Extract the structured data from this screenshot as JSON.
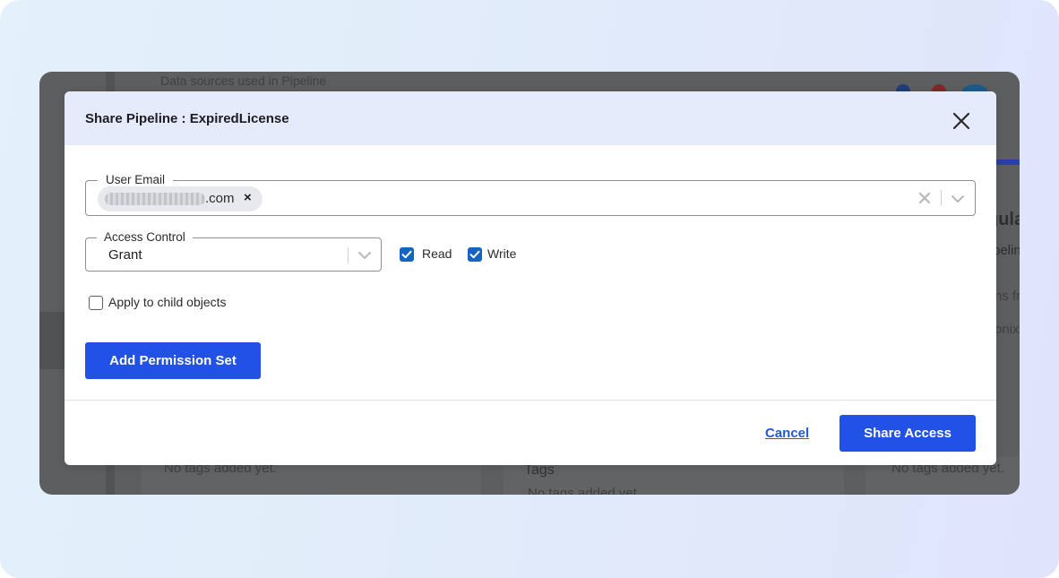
{
  "background": {
    "snippets": [
      "Data sources used in Pipeline",
      "No tags added yet.",
      "Tags",
      "No tags added yet.",
      "No tags added yet.",
      "gula",
      "pelin",
      "ns fr",
      "onix"
    ]
  },
  "modal": {
    "title": "Share Pipeline : ExpiredLicense",
    "user_email": {
      "label": "User Email",
      "chip_suffix": ".com",
      "chip_remove": "×"
    },
    "access_control": {
      "label": "Access Control",
      "value": "Grant"
    },
    "permissions": {
      "read_label": "Read",
      "read_checked": true,
      "write_label": "Write",
      "write_checked": true
    },
    "apply_child": {
      "label": "Apply to child objects",
      "checked": false
    },
    "add_permission_set_label": "Add Permission Set",
    "cancel_label": "Cancel",
    "share_access_label": "Share Access"
  },
  "colors": {
    "primary": "#2251e6",
    "checkbox": "#1565c0",
    "header_bg": "#e6ebfb",
    "link": "#2459d6"
  }
}
